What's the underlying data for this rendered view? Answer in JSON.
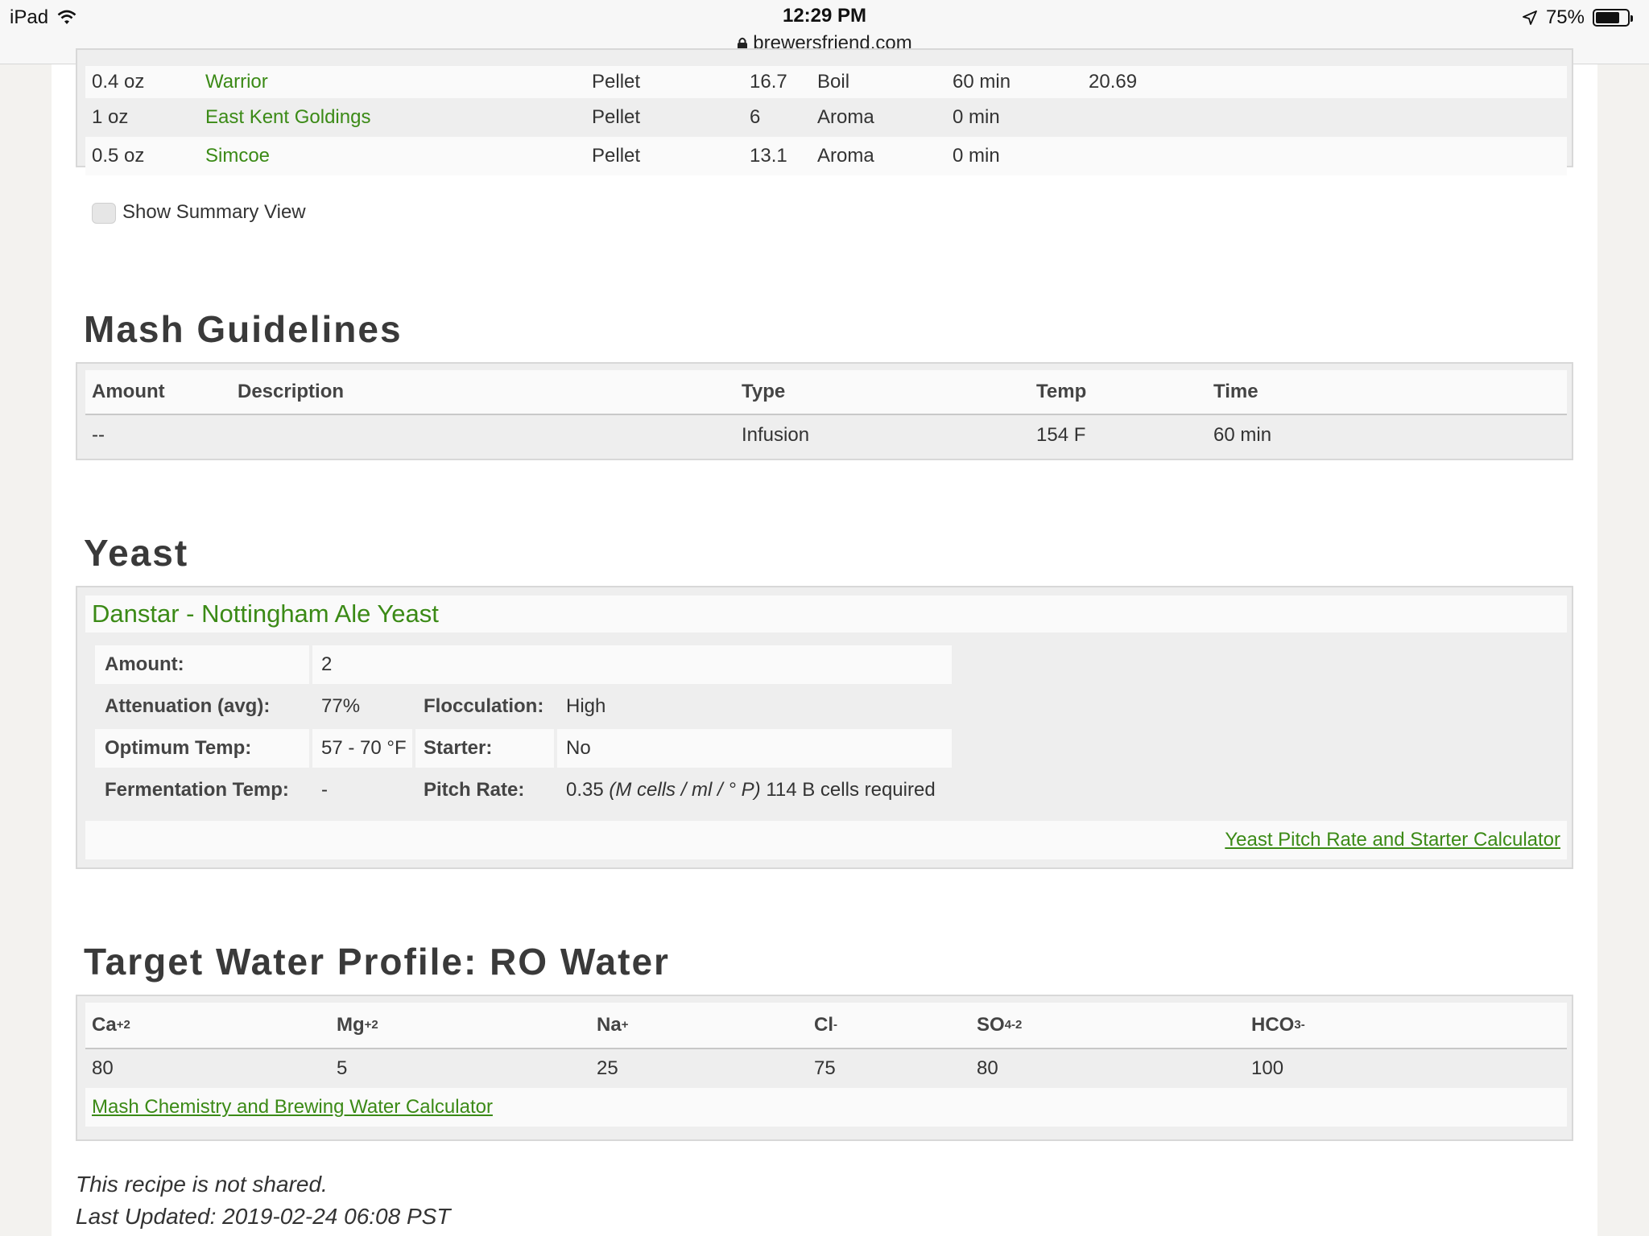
{
  "status_bar": {
    "device": "iPad",
    "time": "12:29 PM",
    "url": "brewersfriend.com",
    "battery": "75%"
  },
  "hops": {
    "rows": [
      {
        "amount": "0.4 oz",
        "variety": "Warrior",
        "type": "Pellet",
        "aa": "16.7",
        "use": "Boil",
        "time": "60 min",
        "ibu": "20.69"
      },
      {
        "amount": "1 oz",
        "variety": "East Kent Goldings",
        "type": "Pellet",
        "aa": "6",
        "use": "Aroma",
        "time": "0 min",
        "ibu": ""
      },
      {
        "amount": "0.5 oz",
        "variety": "Simcoe",
        "type": "Pellet",
        "aa": "13.1",
        "use": "Aroma",
        "time": "0 min",
        "ibu": ""
      }
    ],
    "summary_toggle_label": "Show Summary View"
  },
  "mash": {
    "title": "Mash Guidelines",
    "headers": {
      "amount": "Amount",
      "description": "Description",
      "type": "Type",
      "temp": "Temp",
      "time": "Time"
    },
    "rows": [
      {
        "amount": "--",
        "description": "",
        "type": "Infusion",
        "temp": "154 F",
        "time": "60 min"
      }
    ]
  },
  "yeast": {
    "title": "Yeast",
    "name": "Danstar - Nottingham Ale Yeast",
    "amount_label": "Amount:",
    "amount": "2",
    "attenuation_label": "Attenuation (avg):",
    "attenuation": "77%",
    "flocculation_label": "Flocculation:",
    "flocculation": "High",
    "optimum_temp_label": "Optimum Temp:",
    "optimum_temp": "57 - 70 °F",
    "starter_label": "Starter:",
    "starter": "No",
    "fermentation_temp_label": "Fermentation Temp:",
    "fermentation_temp": "-",
    "pitch_rate_label": "Pitch Rate:",
    "pitch_rate_value": "0.35",
    "pitch_rate_units": "(M cells / ml / ° P)",
    "pitch_rate_note": "114 B cells required",
    "calculator_link": "Yeast Pitch Rate and Starter Calculator"
  },
  "water": {
    "title": "Target Water Profile: RO Water",
    "headers": [
      {
        "base": "Ca",
        "sub": "",
        "sup": "+2"
      },
      {
        "base": "Mg",
        "sub": "",
        "sup": "+2"
      },
      {
        "base": "Na",
        "sub": "",
        "sup": "+"
      },
      {
        "base": "Cl",
        "sub": "",
        "sup": "-"
      },
      {
        "base": "SO",
        "sub": "4",
        "sup": "-2"
      },
      {
        "base": "HCO",
        "sub": "3",
        "sup": "-"
      }
    ],
    "values": [
      "80",
      "5",
      "25",
      "75",
      "80",
      "100"
    ],
    "calculator_link": "Mash Chemistry and Brewing Water Calculator"
  },
  "footer": {
    "shared_note": "This recipe is not shared.",
    "last_updated": "Last Updated: 2019-02-24 06:08 PST"
  }
}
